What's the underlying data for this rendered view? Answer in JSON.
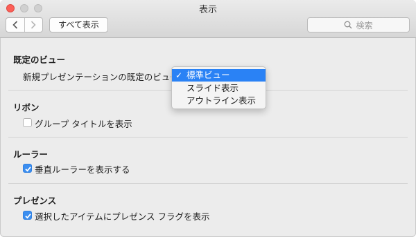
{
  "window": {
    "title": "表示"
  },
  "toolbar": {
    "show_all_label": "すべて表示",
    "search_placeholder": "検索"
  },
  "sections": {
    "default_view": {
      "title": "既定のビュー",
      "row_label": "新規プレゼンテーションの既定のビュー:",
      "options": [
        "標準ビュー",
        "スライド表示",
        "アウトライン表示"
      ],
      "selected": "標準ビュー",
      "check_mark": "✓"
    },
    "ribbon": {
      "title": "リボン",
      "checkbox_label": "グループ タイトルを表示",
      "checked": false
    },
    "ruler": {
      "title": "ルーラー",
      "checkbox_label": "垂直ルーラーを表示する",
      "checked": true
    },
    "presence": {
      "title": "プレゼンス",
      "checkbox_label": "選択したアイテムにプレゼンス フラグを表示",
      "checked": true
    }
  },
  "colors": {
    "accent": "#2a82f5",
    "checkbox": "#3b8ef0",
    "close": "#fc5f57"
  }
}
